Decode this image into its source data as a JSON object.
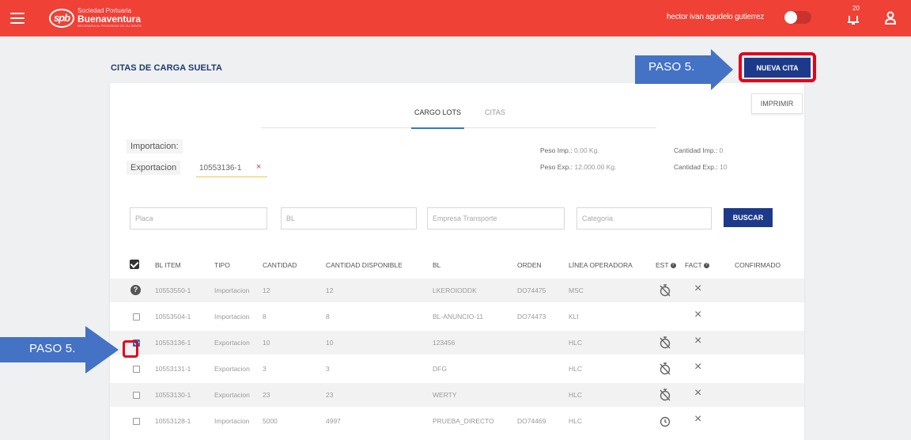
{
  "header": {
    "logo_mark": "spb",
    "logo_line1": "Sociedad Portuaria",
    "logo_line2": "Buenaventura",
    "logo_line3": "NECESARIA AL PROGRESO DE SU GENTE",
    "user_name": "hector ivan agudelo gutierrez",
    "notification_count": "20"
  },
  "page_title": "CITAS DE CARGA SUELTA",
  "nueva_cita_label": "NUEVA CITA",
  "imprimir_label": "IMPRIMIR",
  "annotations": {
    "paso_top": "PASO 5.",
    "paso_left": "PASO 5."
  },
  "tabs": [
    {
      "label": "CARGO LOTS",
      "active": true
    },
    {
      "label": "CITAS",
      "active": false
    }
  ],
  "filters": {
    "importacion_label": "Importacion:",
    "exportacion_label": "Exportacion",
    "exportacion_value": "10553136-1",
    "remove_symbol": "×"
  },
  "summary": {
    "peso_imp_label": "Peso Imp.:",
    "peso_imp_value": "0.00 Kg.",
    "peso_exp_label": "Peso Exp.:",
    "peso_exp_value": "12.000.00 Kg.",
    "cantidad_imp_label": "Cantidad Imp.:",
    "cantidad_imp_value": "0",
    "cantidad_exp_label": "Cantidad Exp.:",
    "cantidad_exp_value": "10"
  },
  "search": {
    "placa_placeholder": "Placa",
    "bl_placeholder": "BL",
    "empresa_placeholder": "Empresa Transporte",
    "categoria_placeholder": "Categoria",
    "buscar_label": "BUSCAR"
  },
  "table": {
    "columns": [
      "BL ITEM",
      "TIPO",
      "CANTIDAD",
      "CANTIDAD DISPONIBLE",
      "BL",
      "ORDEN",
      "LÍNEA OPERADORA",
      "EST",
      "FACT",
      "CONFIRMADO"
    ],
    "rows": [
      {
        "bl_item": "10553550-1",
        "tipo": "Importacion",
        "cantidad": "12",
        "disponible": "12",
        "bl": "LKEROIODDK",
        "orden": "DO74475",
        "linea": "MSC",
        "est": "stopwatch-off",
        "fact": "×",
        "select": "help"
      },
      {
        "bl_item": "10553504-1",
        "tipo": "Importacion",
        "cantidad": "8",
        "disponible": "8",
        "bl": "BL-ANUNCIO-11",
        "orden": "DO74473",
        "linea": "KLI",
        "est": "",
        "fact": "×",
        "select": "unchecked"
      },
      {
        "bl_item": "10553136-1",
        "tipo": "Exportacion",
        "cantidad": "10",
        "disponible": "10",
        "bl": "123456",
        "orden": "",
        "linea": "HLC",
        "est": "stopwatch-off",
        "fact": "×",
        "select": "checked"
      },
      {
        "bl_item": "10553131-1",
        "tipo": "Exportacion",
        "cantidad": "3",
        "disponible": "3",
        "bl": "DFG",
        "orden": "",
        "linea": "HLC",
        "est": "stopwatch-off",
        "fact": "×",
        "select": "unchecked"
      },
      {
        "bl_item": "10553130-1",
        "tipo": "Exportacion",
        "cantidad": "23",
        "disponible": "23",
        "bl": "WERTY",
        "orden": "",
        "linea": "HLC",
        "est": "stopwatch-off",
        "fact": "×",
        "select": "unchecked"
      },
      {
        "bl_item": "10553128-1",
        "tipo": "Importacion",
        "cantidad": "5000",
        "disponible": "4997",
        "bl": "PRUEBA_DIRECTO",
        "orden": "DO74469",
        "linea": "HLC",
        "est": "clock",
        "fact": "×",
        "select": "unchecked"
      }
    ]
  },
  "colors": {
    "header_red": "#ef4136",
    "primary_blue": "#1d3a8a",
    "annotation_blue": "#4472c4",
    "highlight_red": "#e3001b"
  }
}
